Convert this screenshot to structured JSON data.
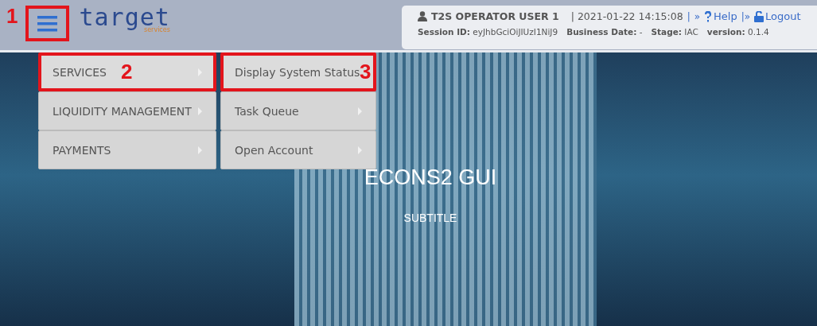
{
  "header": {
    "logo": {
      "name": "target",
      "tagline": "services"
    },
    "user": "T2S OPERATOR USER 1",
    "datetime": "| 2021-01-22 14:15:08",
    "help": "Help",
    "logout": "Logout",
    "sep1": "|",
    "sep2": "»",
    "sep3": "|»",
    "session": [
      {
        "label": "Session ID:",
        "value": "eyJhbGciOiJIUzI1NiJ9"
      },
      {
        "label": "Business Date:",
        "value": "-"
      },
      {
        "label": "Stage:",
        "value": "IAC"
      },
      {
        "label": "version:",
        "value": "0.1.4"
      }
    ]
  },
  "menu": {
    "items": [
      {
        "label": "SERVICES",
        "selected": true
      },
      {
        "label": "LIQUIDITY MANAGEMENT",
        "selected": false
      },
      {
        "label": "PAYMENTS",
        "selected": false
      }
    ],
    "submenu": [
      {
        "label": "Display System Status",
        "selected": true
      },
      {
        "label": "Task Queue",
        "selected": false
      },
      {
        "label": "Open Account",
        "selected": false
      }
    ]
  },
  "hero": {
    "title": "ECONS2 GUI",
    "subtitle": "SUBTITLE"
  },
  "callouts": [
    "1",
    "2",
    "3"
  ]
}
